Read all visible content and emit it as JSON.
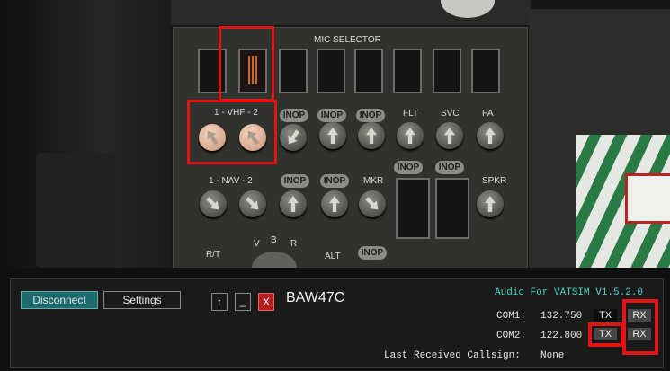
{
  "panel": {
    "mic_selector_label": "MIC SELECTOR",
    "vhf_label": "1 - VHF - 2",
    "nav_label": "1 - NAV - 2",
    "inop": "INOP",
    "flt": "FLT",
    "svc": "SVC",
    "pa": "PA",
    "mkr": "MKR",
    "spkr": "SPKR",
    "rt": "R/T",
    "v": "V",
    "b": "B",
    "r": "R",
    "alt": "ALT"
  },
  "client": {
    "disconnect_label": "Disconnect",
    "settings_label": "Settings",
    "up_label": "↑",
    "minimize_label": "_",
    "close_label": "X",
    "callsign": "BAW47C",
    "app_title": "Audio For VATSIM V1.5.2.0",
    "com1_label": "COM1:",
    "com1_freq": "132.750",
    "com2_label": "COM2:",
    "com2_freq": "122.800",
    "tx_label": "TX",
    "rx_label": "RX",
    "last_received_label": "Last Received Callsign:",
    "last_received_value": "None"
  },
  "colors": {
    "accent": "#1c6b6e",
    "highlight": "#e01515",
    "title_text": "#4fd1c5"
  }
}
